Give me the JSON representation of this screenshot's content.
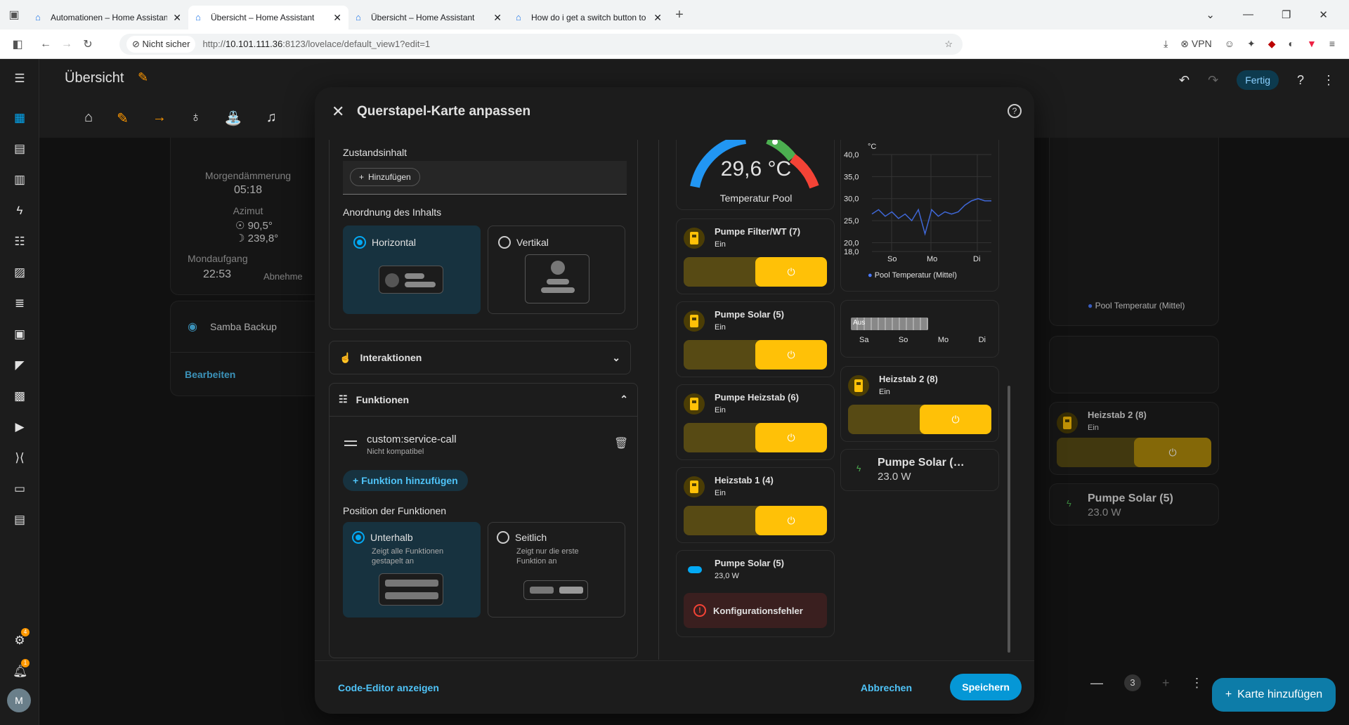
{
  "browser": {
    "tabs": [
      {
        "label": "Automationen – Home Assistan",
        "active": false
      },
      {
        "label": "Übersicht – Home Assistant",
        "active": true
      },
      {
        "label": "Übersicht – Home Assistant",
        "active": false
      },
      {
        "label": "How do i get a switch button to",
        "active": false
      }
    ],
    "not_secure": "Nicht sicher",
    "url_prefix": "http://",
    "url_host": "10.101.111.36",
    "url_rest": ":8123/lovelace/default_view1?edit=1",
    "vpn": "VPN"
  },
  "header": {
    "title": "Übersicht",
    "done_label": "Fertig"
  },
  "background": {
    "sun_card": {
      "dawn_label": "Morgendämmerung",
      "dawn_value": "05:18",
      "azimuth_label": "Azimut",
      "azimuth_sun": "90,5°",
      "azimuth_moon": "239,8°",
      "moonrise_label": "Mondaufgang",
      "moonrise_value": "22:53",
      "moon_phase": "Abnehme"
    },
    "samba_label": "Samba Backup",
    "edit_label": "Bearbeiten",
    "right_chart_legend": "Pool Temperatur (Mittel)",
    "right_heizstab": "Heizstab 2 (8)",
    "right_heizstab_state": "Ein",
    "right_solar": "Pumpe Solar (5)",
    "right_solar_value": "23.0 W",
    "pager_number": "3",
    "add_card_label": "Karte hinzufügen",
    "sidebar_badge_settings": "4",
    "sidebar_badge_notifications": "1",
    "avatar_letter": "M"
  },
  "modal": {
    "title": "Querstapel-Karte anpassen",
    "state_content_label": "Zustandsinhalt",
    "add_label": "Hinzufügen",
    "content_layout_label": "Anordnung des Inhalts",
    "horizontal_label": "Horizontal",
    "vertical_label": "Vertikal",
    "interactions_label": "Interaktionen",
    "functions_label": "Funktionen",
    "feature_name": "custom:service-call",
    "feature_sub": "Nicht kompatibel",
    "add_function_label": "Funktion hinzufügen",
    "features_position_label": "Position der Funktionen",
    "below_label": "Unterhalb",
    "below_sub": "Zeigt alle Funktionen gestapelt an",
    "inline_label": "Seitlich",
    "inline_sub": "Zeigt nur die erste Funktion an",
    "code_editor_label": "Code-Editor anzeigen",
    "cancel_label": "Abbrechen",
    "save_label": "Speichern"
  },
  "preview": {
    "gauge_value": "29,6 °C",
    "gauge_name": "Temperatur Pool",
    "tiles": [
      {
        "name": "Pumpe Filter/WT (7)",
        "state": "Ein"
      },
      {
        "name": "Pumpe Solar (5)",
        "state": "Ein"
      },
      {
        "name": "Pumpe Heizstab (6)",
        "state": "Ein"
      },
      {
        "name": "Heizstab 1 (4)",
        "state": "Ein"
      }
    ],
    "heizstab2_name": "Heizstab 2 (8)",
    "heizstab2_state": "Ein",
    "solar_power_name": "Pumpe Solar (…",
    "solar_power_value": "23.0 W",
    "switch_name": "Pumpe Solar (5)",
    "switch_value": "23,0 W",
    "config_error": "Konfigurationsfehler",
    "history_off": "Aus",
    "history_days": [
      "Sa",
      "So",
      "Mo",
      "Di"
    ],
    "chart_legend": "Pool Temperatur (Mittel)"
  },
  "chart_data": {
    "type": "line",
    "ylabel": "°C",
    "yticks": [
      "40,0",
      "35,0",
      "30,0",
      "25,0",
      "20,0",
      "18,0"
    ],
    "ylim": [
      18,
      40
    ],
    "xticks": [
      "So",
      "Mo",
      "Di"
    ],
    "series": [
      {
        "name": "Pool Temperatur (Mittel)",
        "values": [
          26.5,
          27.5,
          26.0,
          27.0,
          25.5,
          26.5,
          25.0,
          27.5,
          22.0,
          27.5,
          26.0,
          27.0,
          26.5,
          27.0,
          28.5,
          29.5,
          30.0,
          29.5,
          29.5
        ]
      }
    ],
    "color": "#3f67d6"
  }
}
